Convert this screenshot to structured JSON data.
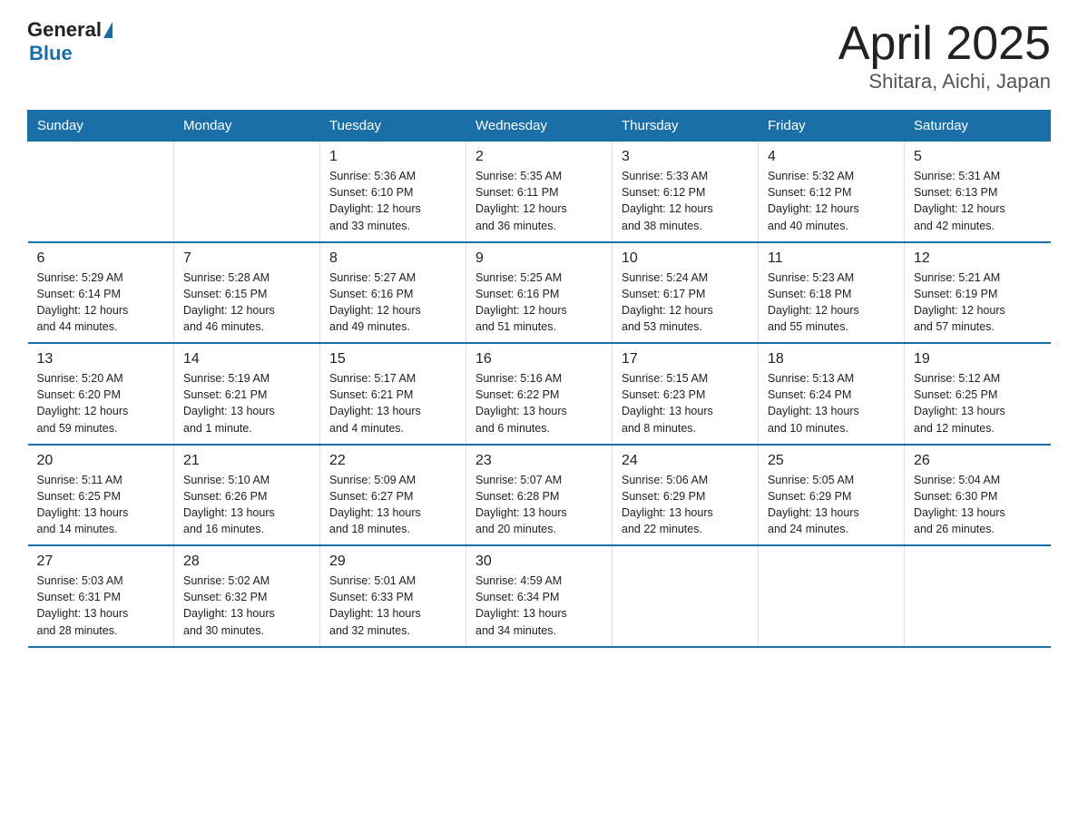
{
  "logo": {
    "general": "General",
    "triangle": "",
    "blue": "Blue"
  },
  "title": "April 2025",
  "subtitle": "Shitara, Aichi, Japan",
  "days_of_week": [
    "Sunday",
    "Monday",
    "Tuesday",
    "Wednesday",
    "Thursday",
    "Friday",
    "Saturday"
  ],
  "weeks": [
    [
      {
        "day": "",
        "info": ""
      },
      {
        "day": "",
        "info": ""
      },
      {
        "day": "1",
        "info": "Sunrise: 5:36 AM\nSunset: 6:10 PM\nDaylight: 12 hours\nand 33 minutes."
      },
      {
        "day": "2",
        "info": "Sunrise: 5:35 AM\nSunset: 6:11 PM\nDaylight: 12 hours\nand 36 minutes."
      },
      {
        "day": "3",
        "info": "Sunrise: 5:33 AM\nSunset: 6:12 PM\nDaylight: 12 hours\nand 38 minutes."
      },
      {
        "day": "4",
        "info": "Sunrise: 5:32 AM\nSunset: 6:12 PM\nDaylight: 12 hours\nand 40 minutes."
      },
      {
        "day": "5",
        "info": "Sunrise: 5:31 AM\nSunset: 6:13 PM\nDaylight: 12 hours\nand 42 minutes."
      }
    ],
    [
      {
        "day": "6",
        "info": "Sunrise: 5:29 AM\nSunset: 6:14 PM\nDaylight: 12 hours\nand 44 minutes."
      },
      {
        "day": "7",
        "info": "Sunrise: 5:28 AM\nSunset: 6:15 PM\nDaylight: 12 hours\nand 46 minutes."
      },
      {
        "day": "8",
        "info": "Sunrise: 5:27 AM\nSunset: 6:16 PM\nDaylight: 12 hours\nand 49 minutes."
      },
      {
        "day": "9",
        "info": "Sunrise: 5:25 AM\nSunset: 6:16 PM\nDaylight: 12 hours\nand 51 minutes."
      },
      {
        "day": "10",
        "info": "Sunrise: 5:24 AM\nSunset: 6:17 PM\nDaylight: 12 hours\nand 53 minutes."
      },
      {
        "day": "11",
        "info": "Sunrise: 5:23 AM\nSunset: 6:18 PM\nDaylight: 12 hours\nand 55 minutes."
      },
      {
        "day": "12",
        "info": "Sunrise: 5:21 AM\nSunset: 6:19 PM\nDaylight: 12 hours\nand 57 minutes."
      }
    ],
    [
      {
        "day": "13",
        "info": "Sunrise: 5:20 AM\nSunset: 6:20 PM\nDaylight: 12 hours\nand 59 minutes."
      },
      {
        "day": "14",
        "info": "Sunrise: 5:19 AM\nSunset: 6:21 PM\nDaylight: 13 hours\nand 1 minute."
      },
      {
        "day": "15",
        "info": "Sunrise: 5:17 AM\nSunset: 6:21 PM\nDaylight: 13 hours\nand 4 minutes."
      },
      {
        "day": "16",
        "info": "Sunrise: 5:16 AM\nSunset: 6:22 PM\nDaylight: 13 hours\nand 6 minutes."
      },
      {
        "day": "17",
        "info": "Sunrise: 5:15 AM\nSunset: 6:23 PM\nDaylight: 13 hours\nand 8 minutes."
      },
      {
        "day": "18",
        "info": "Sunrise: 5:13 AM\nSunset: 6:24 PM\nDaylight: 13 hours\nand 10 minutes."
      },
      {
        "day": "19",
        "info": "Sunrise: 5:12 AM\nSunset: 6:25 PM\nDaylight: 13 hours\nand 12 minutes."
      }
    ],
    [
      {
        "day": "20",
        "info": "Sunrise: 5:11 AM\nSunset: 6:25 PM\nDaylight: 13 hours\nand 14 minutes."
      },
      {
        "day": "21",
        "info": "Sunrise: 5:10 AM\nSunset: 6:26 PM\nDaylight: 13 hours\nand 16 minutes."
      },
      {
        "day": "22",
        "info": "Sunrise: 5:09 AM\nSunset: 6:27 PM\nDaylight: 13 hours\nand 18 minutes."
      },
      {
        "day": "23",
        "info": "Sunrise: 5:07 AM\nSunset: 6:28 PM\nDaylight: 13 hours\nand 20 minutes."
      },
      {
        "day": "24",
        "info": "Sunrise: 5:06 AM\nSunset: 6:29 PM\nDaylight: 13 hours\nand 22 minutes."
      },
      {
        "day": "25",
        "info": "Sunrise: 5:05 AM\nSunset: 6:29 PM\nDaylight: 13 hours\nand 24 minutes."
      },
      {
        "day": "26",
        "info": "Sunrise: 5:04 AM\nSunset: 6:30 PM\nDaylight: 13 hours\nand 26 minutes."
      }
    ],
    [
      {
        "day": "27",
        "info": "Sunrise: 5:03 AM\nSunset: 6:31 PM\nDaylight: 13 hours\nand 28 minutes."
      },
      {
        "day": "28",
        "info": "Sunrise: 5:02 AM\nSunset: 6:32 PM\nDaylight: 13 hours\nand 30 minutes."
      },
      {
        "day": "29",
        "info": "Sunrise: 5:01 AM\nSunset: 6:33 PM\nDaylight: 13 hours\nand 32 minutes."
      },
      {
        "day": "30",
        "info": "Sunrise: 4:59 AM\nSunset: 6:34 PM\nDaylight: 13 hours\nand 34 minutes."
      },
      {
        "day": "",
        "info": ""
      },
      {
        "day": "",
        "info": ""
      },
      {
        "day": "",
        "info": ""
      }
    ]
  ]
}
